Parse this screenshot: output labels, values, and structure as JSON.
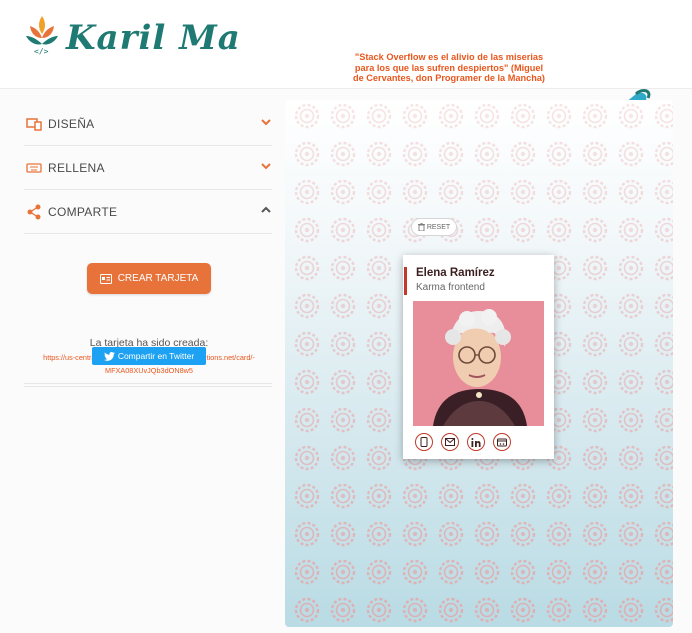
{
  "brand": {
    "name": "Karil Ma",
    "logo_icon": "lotus-code-icon"
  },
  "quote": "\"Stack Overflow es el alivio de las miserias para los que las sufren despiertos\" (Miguel de Cervantes, don Programer de la Mancha)",
  "sections": [
    {
      "label": "DISEÑA",
      "icon": "palette-icon",
      "state": "collapsed"
    },
    {
      "label": "RELLENA",
      "icon": "keyboard-icon",
      "state": "collapsed"
    },
    {
      "label": "COMPARTE",
      "icon": "share-icon",
      "state": "expanded"
    }
  ],
  "share": {
    "create_button": "CREAR TARJETA",
    "created_label": "La tarjeta ha sido creada:",
    "link_line1": "https://us-central1-awesome-cards-cf6f0.cloudfunctions.net/card/-",
    "link_line2": "MFXA08XUvJQb3dON8w5",
    "twitter_button": "Compartir en Twitter"
  },
  "preview": {
    "reset_label": "RESET",
    "card": {
      "name": "Elena Ramírez",
      "job": "Karma frontend"
    },
    "social_icons": [
      "mobile-icon",
      "email-icon",
      "linkedin-icon",
      "github-icon"
    ]
  },
  "colors": {
    "accent": "#e8733a",
    "brand_teal": "#1f7a73",
    "card_red": "#c0392b",
    "twitter": "#1da1f2"
  }
}
